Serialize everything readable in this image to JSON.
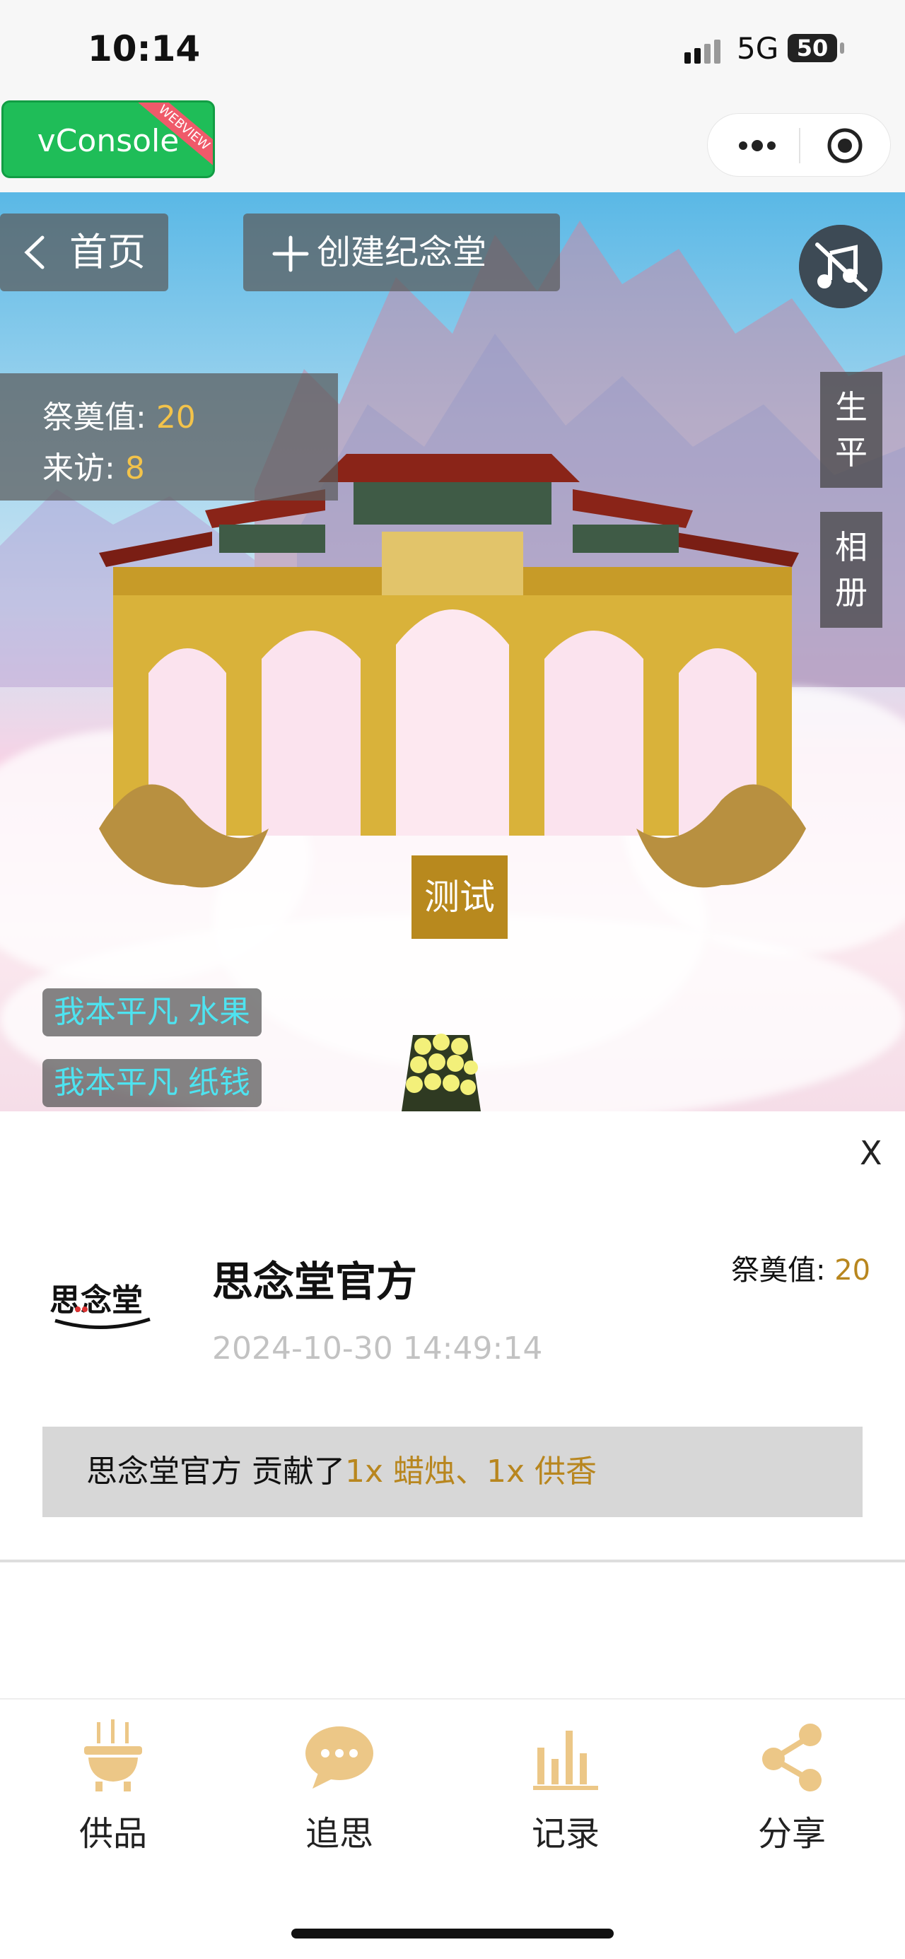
{
  "status_bar": {
    "time": "10:14",
    "network": "5G",
    "battery": "50"
  },
  "navbar": {
    "vconsole_label": "vConsole",
    "vconsole_badge": "WEBVIEW"
  },
  "header": {
    "back_label": "首页",
    "create_label": "创建纪念堂"
  },
  "stats": {
    "offering_label": "祭奠值: ",
    "offering_value": "20",
    "visit_label": "来访: ",
    "visit_value": "8"
  },
  "side_tabs": [
    "生平",
    "相册"
  ],
  "scene": {
    "test_button": "测试",
    "messages": [
      {
        "text": "我本平凡 水果"
      },
      {
        "text": "我本平凡 纸钱"
      }
    ]
  },
  "panel": {
    "close_label": "X",
    "logo_text": "思念堂",
    "user_name": "思念堂官方",
    "date": "2024-10-30 14:49:14",
    "score_label": "祭奠值: ",
    "score_value": "20",
    "contribution_user": "思念堂官方 贡献了",
    "contribution_items": "1x 蜡烛、1x 供香"
  },
  "tabbar": {
    "items": [
      {
        "label": "供品",
        "icon": "incense-burner-icon"
      },
      {
        "label": "追思",
        "icon": "chat-bubble-icon"
      },
      {
        "label": "记录",
        "icon": "bar-chart-icon"
      },
      {
        "label": "分享",
        "icon": "share-icon"
      }
    ],
    "icon_color": "#ecc787"
  }
}
